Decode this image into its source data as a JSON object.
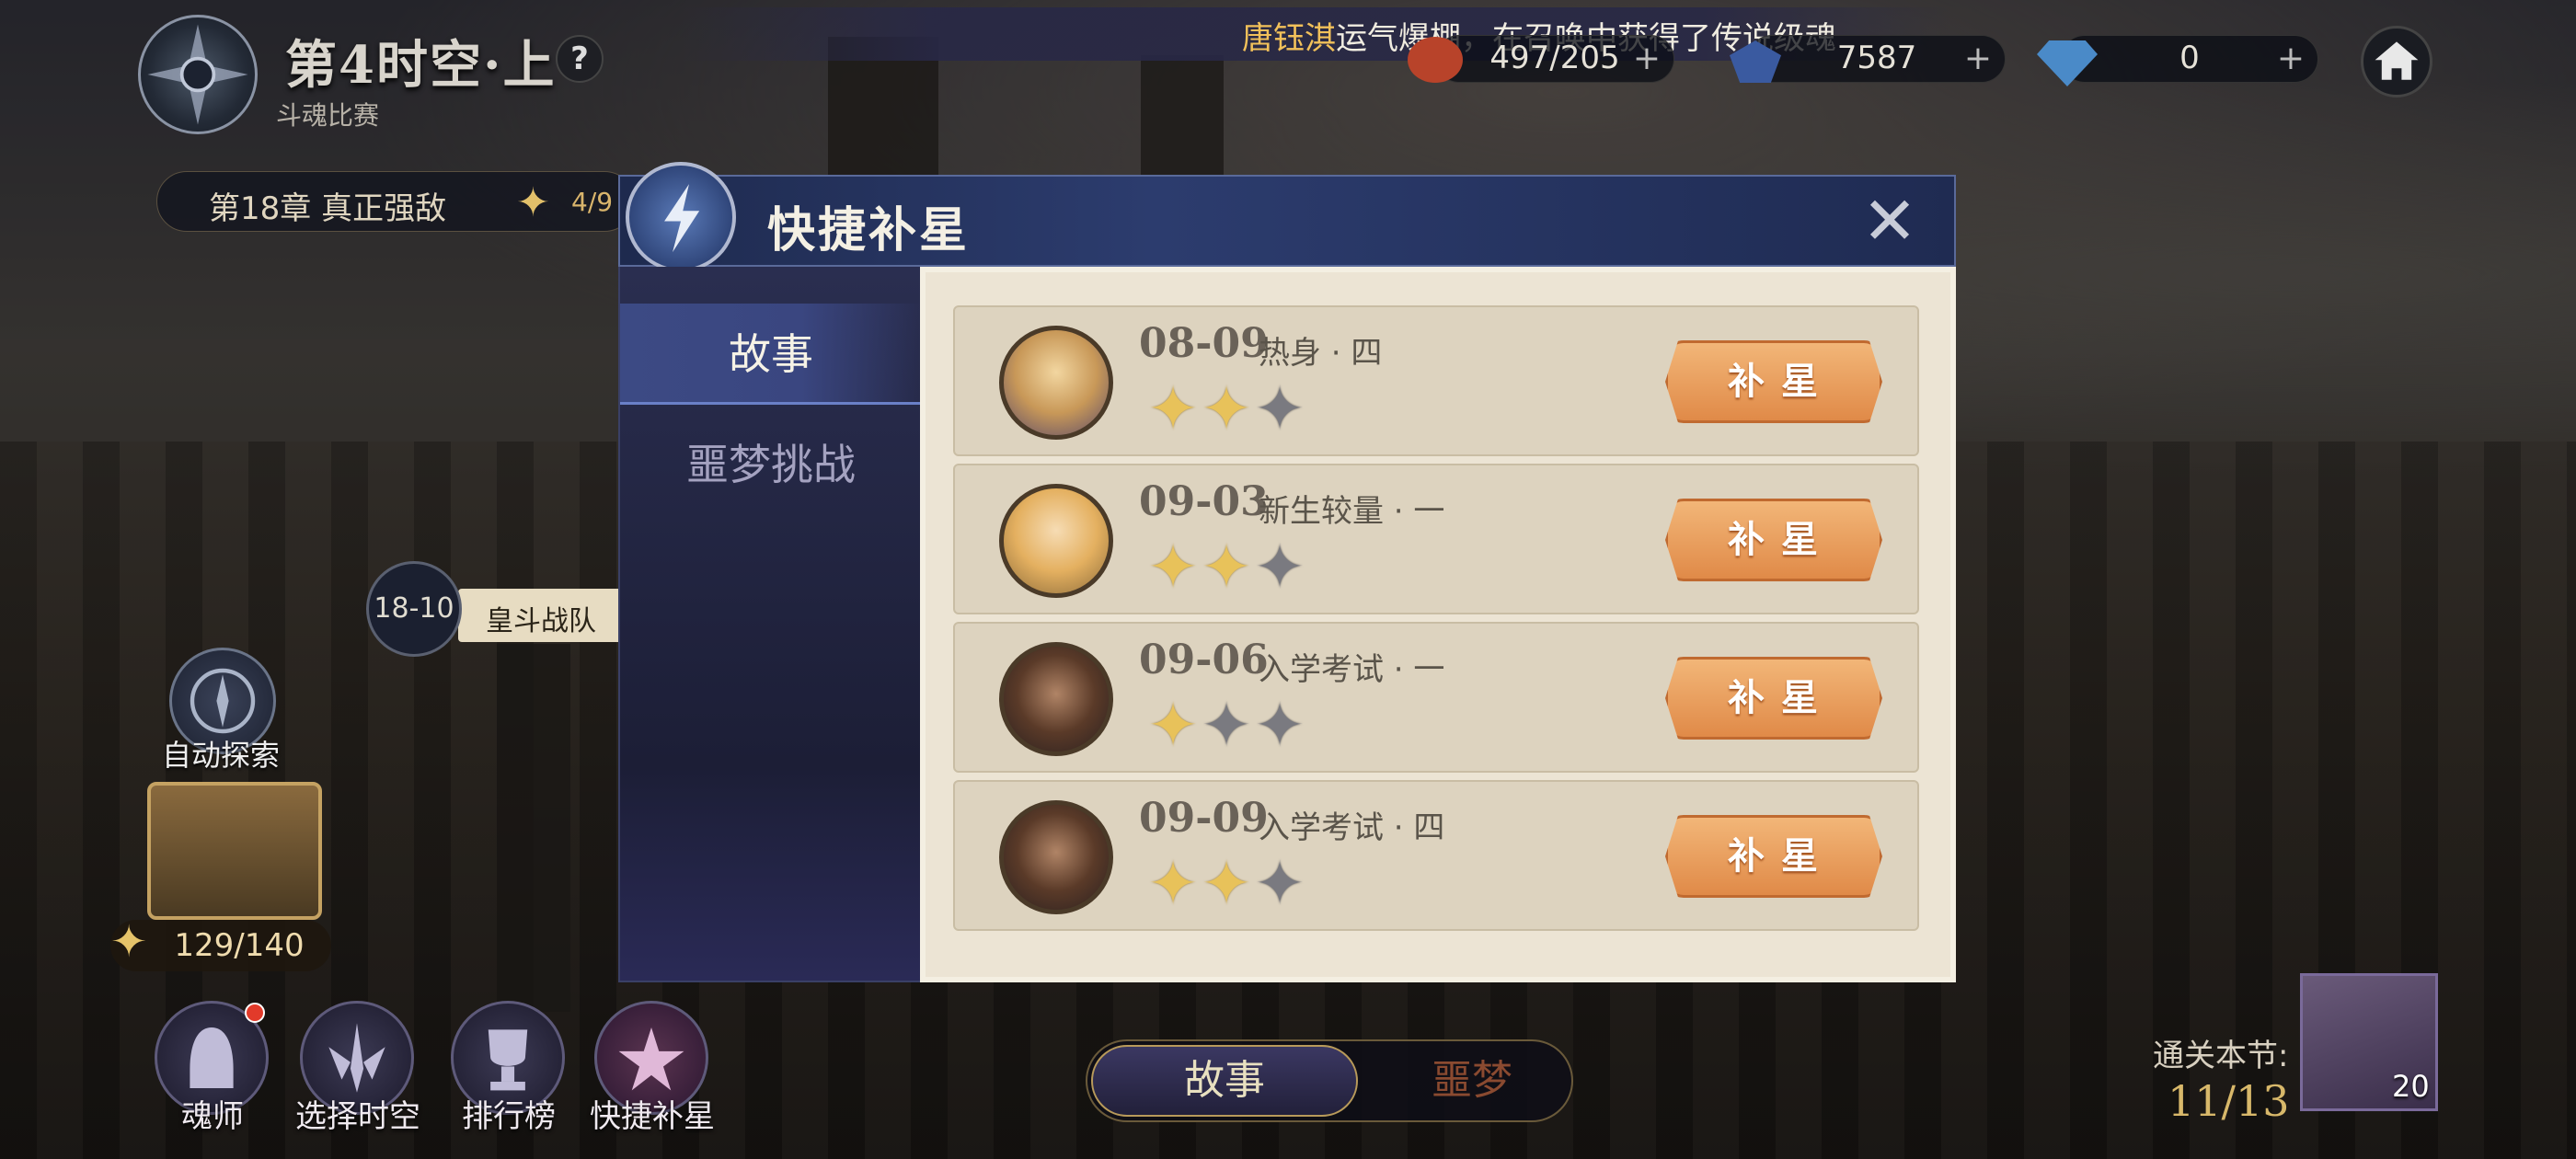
{
  "header": {
    "era_title": "第4时空·上",
    "era_subtitle": "斗魂比赛",
    "help_label": "?",
    "broadcast": {
      "highlight": "唐钰淇",
      "text": "运气爆棚，在召唤中获得了传说级魂"
    },
    "resources": [
      {
        "icon": "food-icon",
        "value": "497/205"
      },
      {
        "icon": "crystal-icon",
        "value": "7587"
      },
      {
        "icon": "diamond-icon",
        "value": "0"
      }
    ]
  },
  "map": {
    "chapter": {
      "label": "第18章 真正强敌",
      "progress": "4/9"
    },
    "node": {
      "id": "18-10",
      "label": "皇斗战队"
    },
    "auto_explore": "自动探索",
    "chest_count": "129/140"
  },
  "bottom_nav": [
    {
      "label": "魂师",
      "icon": "hooded-figure-icon"
    },
    {
      "label": "选择时空",
      "icon": "sword-emblem-icon"
    },
    {
      "label": "排行榜",
      "icon": "trophy-icon"
    },
    {
      "label": "快捷补星",
      "icon": "star-emblem-icon"
    }
  ],
  "mode_toggle": {
    "story": "故事",
    "nightmare": "噩梦"
  },
  "section_clear": {
    "label": "通关本节:",
    "value": "11/13"
  },
  "player": {
    "level": "20"
  },
  "dialog": {
    "title": "快捷补星",
    "tabs": [
      {
        "label": "故事",
        "active": true
      },
      {
        "label": "噩梦挑战",
        "active": false
      }
    ],
    "rows": [
      {
        "code": "08-09",
        "name": "热身 · 四",
        "stars": 2,
        "max_stars": 3,
        "button": "补星"
      },
      {
        "code": "09-03",
        "name": "新生较量 · 一",
        "stars": 2,
        "max_stars": 3,
        "button": "补星"
      },
      {
        "code": "09-06",
        "name": "入学考试 · 一",
        "stars": 1,
        "max_stars": 3,
        "button": "补星"
      },
      {
        "code": "09-09",
        "name": "入学考试 · 四",
        "stars": 2,
        "max_stars": 3,
        "button": "补星"
      }
    ]
  },
  "colors": {
    "accent_gold": "#e8c25a",
    "button_orange": "#e08a48",
    "dialog_navy": "#2c3c6e"
  }
}
